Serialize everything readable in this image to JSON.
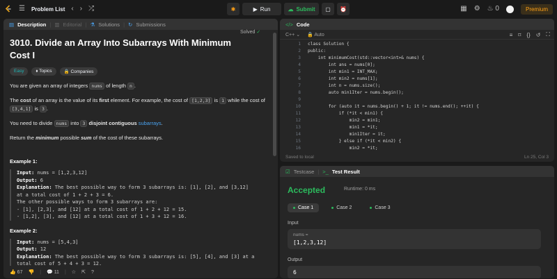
{
  "topbar": {
    "title": "Problem List",
    "run_label": "Run",
    "submit_label": "Submit",
    "streak": "0",
    "premium_label": "Premium"
  },
  "desc_tabs": [
    "Description",
    "Editorial",
    "Solutions",
    "Submissions"
  ],
  "problem": {
    "title": "3010. Divide an Array Into Subarrays With Minimum Cost I",
    "status": "Solved",
    "tags": [
      "Easy",
      "Topics",
      "Companies"
    ],
    "p1_a": "You are given an array of integers ",
    "p1_code": "nums",
    "p1_b": " of length ",
    "p1_code2": "n",
    "p1_c": ".",
    "p2_a": "The ",
    "p2_b": "cost",
    "p2_c": " of an array is the value of its ",
    "p2_d": "first",
    "p2_e": " element. For example, the cost of ",
    "p2_code1": "[1,2,3]",
    "p2_f": " is ",
    "p2_code2": "1",
    "p2_g": " while the cost of ",
    "p2_code3": "[3,4,1]",
    "p2_h": " is ",
    "p2_code4": "3",
    "p2_i": ".",
    "p3_a": "You need to divide ",
    "p3_code1": "nums",
    "p3_b": " into ",
    "p3_code2": "3",
    "p3_c": " disjoint contiguous",
    "p3_link": "subarrays",
    "p3_d": ".",
    "p4_a": "Return the ",
    "p4_b": "minimum",
    "p4_c": " possible ",
    "p4_d": "sum",
    "p4_e": " of the cost of these subarrays.",
    "ex1_title": "Example 1:",
    "ex1_input": "nums = [1,2,3,12]",
    "ex1_output": "6",
    "ex1_expl": [
      "The best possible way to form 3 subarrays is: [1], [2], and [3,12]",
      "at a total cost of 1 + 2 + 3 = 6.",
      "The other possible ways to form 3 subarrays are:",
      "- [1], [2,3], and [12] at a total cost of 1 + 2 + 12 = 15.",
      "- [1,2], [3], and [12] at a total cost of 1 + 3 + 12 = 16."
    ],
    "ex2_title": "Example 2:",
    "ex2_input": "nums = [5,4,3]",
    "ex2_output": "12",
    "ex2_expl": [
      "The best possible way to form 3 subarrays is: [5], [4], and [3] at a",
      "total cost of 5 + 4 + 3 = 12."
    ]
  },
  "labels": {
    "input": "Input:",
    "output": "Output:",
    "explanation": "Explanation:"
  },
  "desc_footer": {
    "likes": "67",
    "comments": "11"
  },
  "code_panel": {
    "tab": "Code",
    "language": "C++",
    "mode": "Auto",
    "saved": "Saved to local",
    "cursor": "Ln 25, Col 3",
    "line_numbers": [
      "1",
      "2",
      "3",
      "4",
      "5",
      "6",
      "7",
      "8",
      "9",
      "10",
      "11",
      "12",
      "13",
      "14",
      "15",
      "16"
    ],
    "lines": [
      "class Solution {",
      "public:",
      "    int minimumCost(std::vector<int>& nums) {",
      "        int ans = nums[0];",
      "        int min1 = INT_MAX;",
      "        int min2 = nums[1];",
      "        int n = nums.size();",
      "        auto min1Iter = nums.begin();",
      "",
      "        for (auto it = nums.begin() + 1; it != nums.end(); ++it) {",
      "            if (*it < min1) {",
      "                min2 = min1;",
      "                min1 = *it;",
      "                min1Iter = it;",
      "            } else if (*it < min2) {",
      "                min2 = *it;"
    ]
  },
  "result_panel": {
    "tabs": [
      "Testcase",
      "Test Result"
    ],
    "status": "Accepted",
    "runtime": "Runtime: 0 ms",
    "cases": [
      "Case 1",
      "Case 2",
      "Case 3"
    ],
    "input_label": "Input",
    "var_label": "nums =",
    "input_value": "[1,2,3,12]",
    "output_label": "Output",
    "output_value": "6"
  },
  "colors": {
    "accent": "#ffa116",
    "success": "#2cbb5d",
    "link": "#4aa3f0"
  }
}
